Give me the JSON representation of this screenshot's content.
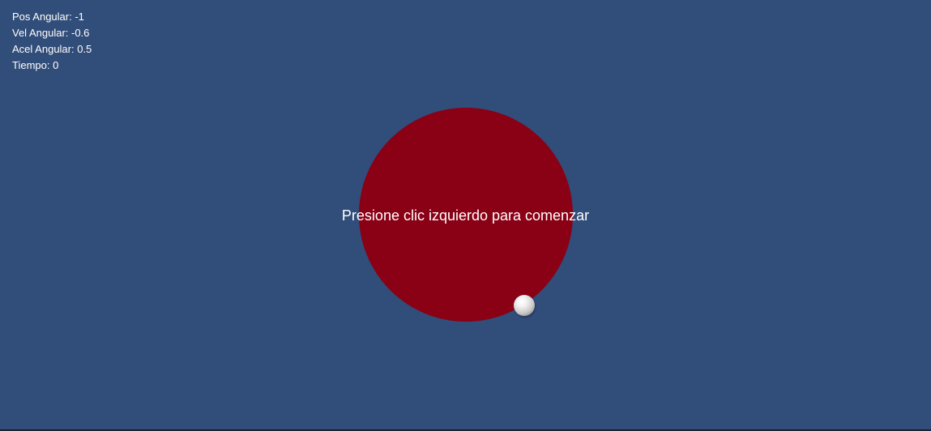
{
  "hud": {
    "pos_angular": "Pos Angular: -1",
    "vel_angular": "Vel Angular: -0.6",
    "acel_angular": "Acel Angular: 0.5",
    "tiempo": "Tiempo: 0"
  },
  "prompt": "Presione clic izquierdo para comenzar",
  "colors": {
    "background": "#314D79",
    "disk": "#8A0015",
    "text": "#FFFFFF",
    "ball": "#F0F0F0"
  }
}
